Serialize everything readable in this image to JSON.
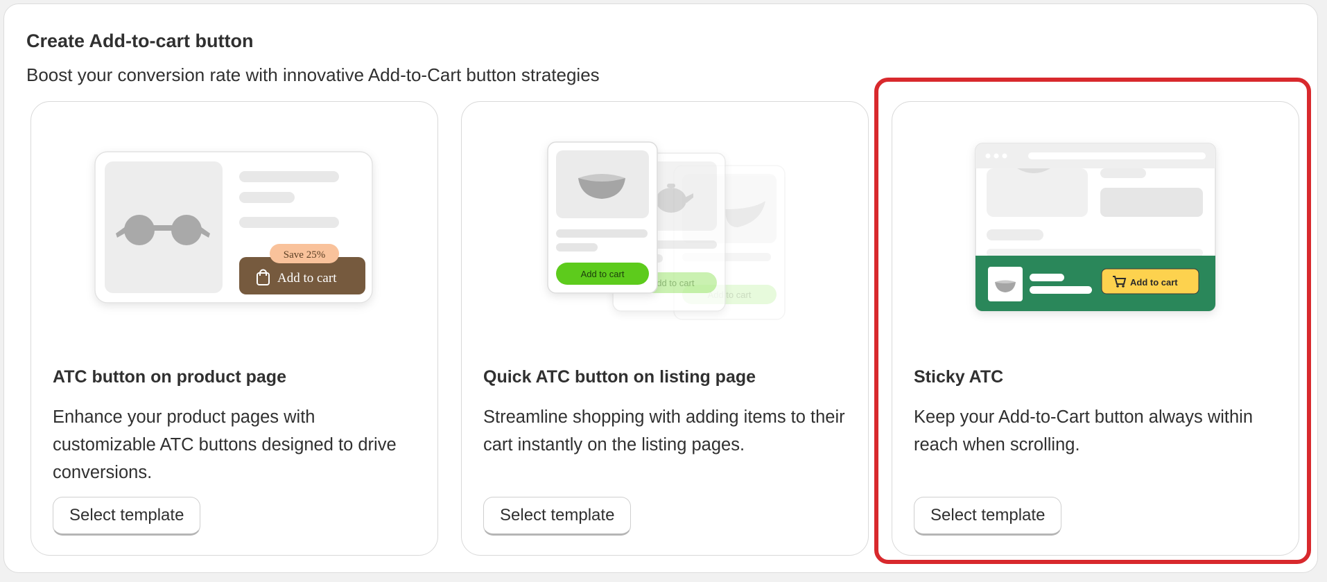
{
  "section": {
    "title": "Create Add-to-cart button",
    "subtitle": "Boost your conversion rate with innovative Add-to-Cart button strategies"
  },
  "cards": [
    {
      "title": "ATC button on product page",
      "description": "Enhance your product pages with customizable ATC buttons designed to drive conversions.",
      "button_label": "Select template",
      "illustration": {
        "badge": "Save 25%",
        "button": "Add to cart",
        "icons": [
          "sunglasses-icon",
          "shopping-bag-icon"
        ],
        "colors": {
          "button": "#765a3e",
          "badge": "#f9c29b"
        }
      }
    },
    {
      "title": "Quick ATC button on listing page",
      "description": "Streamline shopping with adding items to their cart instantly on the listing pages.",
      "button_label": "Select template",
      "illustration": {
        "button": "Add to cart",
        "icons": [
          "bowl-icon",
          "teapot-icon"
        ],
        "colors": {
          "button": "#5dcb1d"
        }
      }
    },
    {
      "title": "Sticky ATC",
      "description": "Keep your Add-to-Cart button always within reach when scrolling.",
      "button_label": "Select template",
      "illustration": {
        "button": "Add to cart",
        "icons": [
          "bowl-icon",
          "cart-icon"
        ],
        "colors": {
          "bar": "#2a875a",
          "button": "#fdd24e"
        }
      }
    }
  ],
  "highlight": {
    "color": "#d8292d"
  }
}
